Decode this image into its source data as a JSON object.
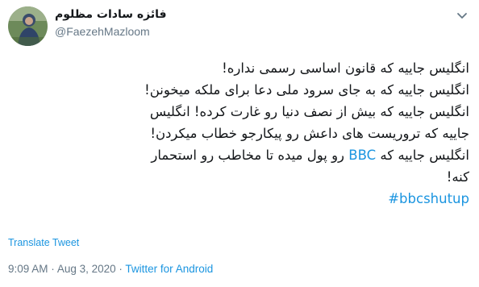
{
  "tweet": {
    "author": {
      "display_name": "فائزه سادات مظلوم",
      "handle": "@FaezehMazloom",
      "avatar_icon": "avatar-photo",
      "menu_icon": "chevron-down-icon"
    },
    "text_lines": {
      "l1": "انگلیس جاییه که قانون اساسی رسمی نداره!",
      "l2": "انگلیس جاییه که به جای سرود ملی دعا برای ملکه میخونن!",
      "l3": "انگلیس جاییه که بیش از نصف دنیا رو غارت کرده! انگلیس",
      "l4": "جاییه که تروریست های داعش رو پیکارجو خطاب میکردن!",
      "l5_before": "انگلیس جاییه که ",
      "l5_mention": "BBC",
      "l5_after": " رو پول میده تا مخاطب رو استحمار",
      "l6": "کنه!",
      "hashtag": "#bbcshutup"
    },
    "translate_label": "Translate Tweet",
    "time": "9:09 AM",
    "separator1": "·",
    "date": "Aug 3, 2020",
    "separator2": "·",
    "source": "Twitter for Android",
    "colors": {
      "link": "#1b95e0",
      "muted": "#657786",
      "text": "#14171a"
    }
  }
}
